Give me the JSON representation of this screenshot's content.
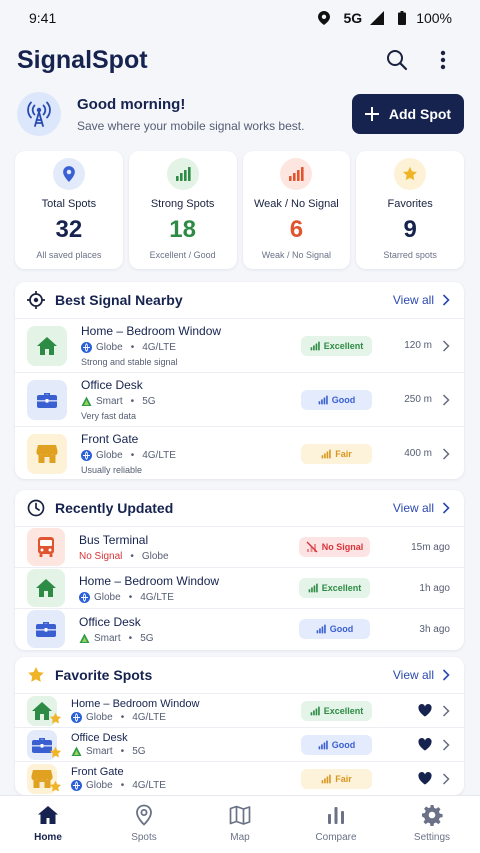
{
  "status": {
    "time": "9:41",
    "network": "5G",
    "battery": "100%"
  },
  "app": {
    "title": "SignalSpot"
  },
  "greeting": {
    "title": "Good morning!",
    "subtitle": "Save where your mobile signal works best.",
    "add_label": "Add Spot"
  },
  "stats": [
    {
      "label": "Total Spots",
      "value": "32",
      "sub": "All saved places",
      "icon": "location-pin-icon",
      "color": "#3a5fd0"
    },
    {
      "label": "Strong Spots",
      "value": "18",
      "sub": "Excellent / Good",
      "icon": "signal-bars-icon",
      "color": "#2e8b45"
    },
    {
      "label": "Weak / No Signal",
      "value": "6",
      "sub": "Weak / No Signal",
      "icon": "signal-bars-icon",
      "color": "#e0552f"
    },
    {
      "label": "Favorites",
      "value": "9",
      "sub": "Starred spots",
      "icon": "star-icon",
      "color": "#16234f"
    }
  ],
  "nearby": {
    "title": "Best Signal Nearby",
    "view_all": "View all",
    "rows": [
      {
        "name": "Home – Bedroom Window",
        "carrier": "Globe",
        "network": "4G/LTE",
        "desc": "Strong and stable signal",
        "badge": "Excellent",
        "distance": "120 m",
        "place": "home"
      },
      {
        "name": "Office Desk",
        "carrier": "Smart",
        "network": "5G",
        "desc": "Very fast data",
        "badge": "Good",
        "distance": "250 m",
        "place": "office"
      },
      {
        "name": "Front Gate",
        "carrier": "Globe",
        "network": "4G/LTE",
        "desc": "Usually reliable",
        "badge": "Fair",
        "distance": "400 m",
        "place": "store"
      }
    ]
  },
  "recent": {
    "title": "Recently Updated",
    "view_all": "View all",
    "rows": [
      {
        "name": "Bus Terminal",
        "status": "No Signal",
        "carrier": "Globe",
        "badge": "No Signal",
        "time": "15m ago",
        "place": "bus"
      },
      {
        "name": "Home – Bedroom Window",
        "carrier": "Globe",
        "network": "4G/LTE",
        "badge": "Excellent",
        "time": "1h ago",
        "place": "home"
      },
      {
        "name": "Office Desk",
        "carrier": "Smart",
        "network": "5G",
        "badge": "Good",
        "time": "3h ago",
        "place": "office"
      }
    ]
  },
  "favorites": {
    "title": "Favorite Spots",
    "view_all": "View all",
    "rows": [
      {
        "name": "Home – Bedroom Window",
        "carrier": "Globe",
        "network": "4G/LTE",
        "badge": "Excellent",
        "place": "home"
      },
      {
        "name": "Office Desk",
        "carrier": "Smart",
        "network": "5G",
        "badge": "Good",
        "place": "office"
      },
      {
        "name": "Front Gate",
        "carrier": "Globe",
        "network": "4G/LTE",
        "badge": "Fair",
        "place": "store"
      }
    ]
  },
  "nav": [
    {
      "label": "Home",
      "icon": "home-icon",
      "active": true
    },
    {
      "label": "Spots",
      "icon": "location-pin-icon",
      "active": false
    },
    {
      "label": "Map",
      "icon": "map-icon",
      "active": false
    },
    {
      "label": "Compare",
      "icon": "bar-chart-icon",
      "active": false
    },
    {
      "label": "Settings",
      "icon": "gear-icon",
      "active": false
    }
  ],
  "colors": {
    "primary": "#16234f",
    "link": "#2a4ab0",
    "excellent": "#2e8b45",
    "good": "#3a5fd0",
    "fair": "#d9961e",
    "nosignal": "#d8343a",
    "home": "#2e8b45",
    "office": "#3a5fd0",
    "store": "#e0a020",
    "bus": "#e0552f"
  }
}
